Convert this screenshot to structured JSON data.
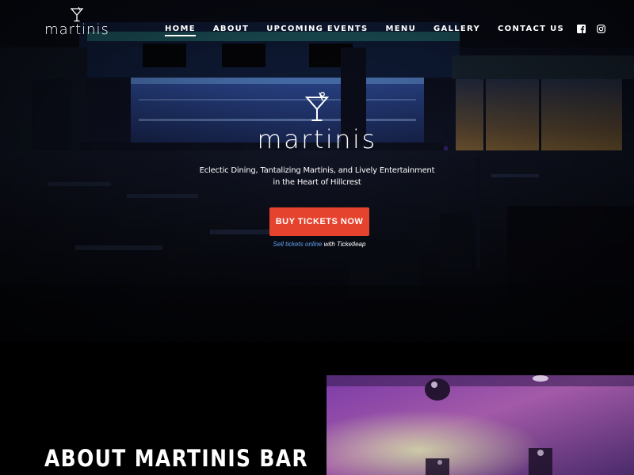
{
  "brand": {
    "name": "martinis",
    "glass_icon": "martini-glass-icon"
  },
  "nav": {
    "items": [
      {
        "label": "HOME",
        "active": true
      },
      {
        "label": "ABOUT",
        "active": false
      },
      {
        "label": "UPCOMING EVENTS",
        "active": false
      },
      {
        "label": "MENU",
        "active": false
      },
      {
        "label": "GALLERY",
        "active": false
      },
      {
        "label": "CONTACT US",
        "active": false
      }
    ],
    "social": [
      "facebook-icon",
      "instagram-icon"
    ]
  },
  "hero": {
    "logo_text": "martinis",
    "tagline_line1": "Eclectic Dining, Tantalizing Martinis, and Lively Entertainment",
    "tagline_line2": "in the Heart of Hillcrest",
    "cta_label": "BUY TICKETS NOW",
    "sell_link": "Sell tickets online",
    "sell_suffix": "with Ticketleap"
  },
  "about": {
    "title": "ABOUT MARTINIS BAR"
  },
  "colors": {
    "accent": "#e5432e",
    "link": "#5fa2ee",
    "background": "#000000"
  }
}
